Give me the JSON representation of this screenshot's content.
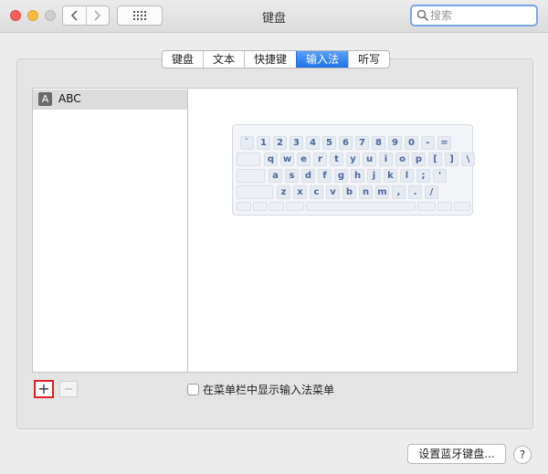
{
  "window": {
    "title": "键盘"
  },
  "toolbar": {
    "search_placeholder": "搜索"
  },
  "tabs": [
    {
      "label": "键盘",
      "active": false
    },
    {
      "label": "文本",
      "active": false
    },
    {
      "label": "快捷键",
      "active": false
    },
    {
      "label": "输入法",
      "active": true
    },
    {
      "label": "听写",
      "active": false
    }
  ],
  "input_sources": [
    {
      "icon_letter": "A",
      "label": "ABC",
      "selected": true
    }
  ],
  "keyboard_preview": {
    "rows": [
      [
        "`",
        "1",
        "2",
        "3",
        "4",
        "5",
        "6",
        "7",
        "8",
        "9",
        "0",
        "-",
        "="
      ],
      [
        "q",
        "w",
        "e",
        "r",
        "t",
        "y",
        "u",
        "i",
        "o",
        "p",
        "[",
        "]",
        "\\"
      ],
      [
        "a",
        "s",
        "d",
        "f",
        "g",
        "h",
        "j",
        "k",
        "l",
        ";",
        "'"
      ],
      [
        "z",
        "x",
        "c",
        "v",
        "b",
        "n",
        "m",
        ",",
        ".",
        "/"
      ]
    ]
  },
  "controls": {
    "add_label": "+",
    "remove_label": "−",
    "show_menu_label": "在菜单栏中显示输入法菜单",
    "show_menu_checked": false,
    "bluetooth_button_label": "设置蓝牙键盘...",
    "help_label": "?"
  },
  "colors": {
    "active_tab": "#1f73e8",
    "highlight_border": "#e02020",
    "key_text": "#4a6aa0"
  }
}
